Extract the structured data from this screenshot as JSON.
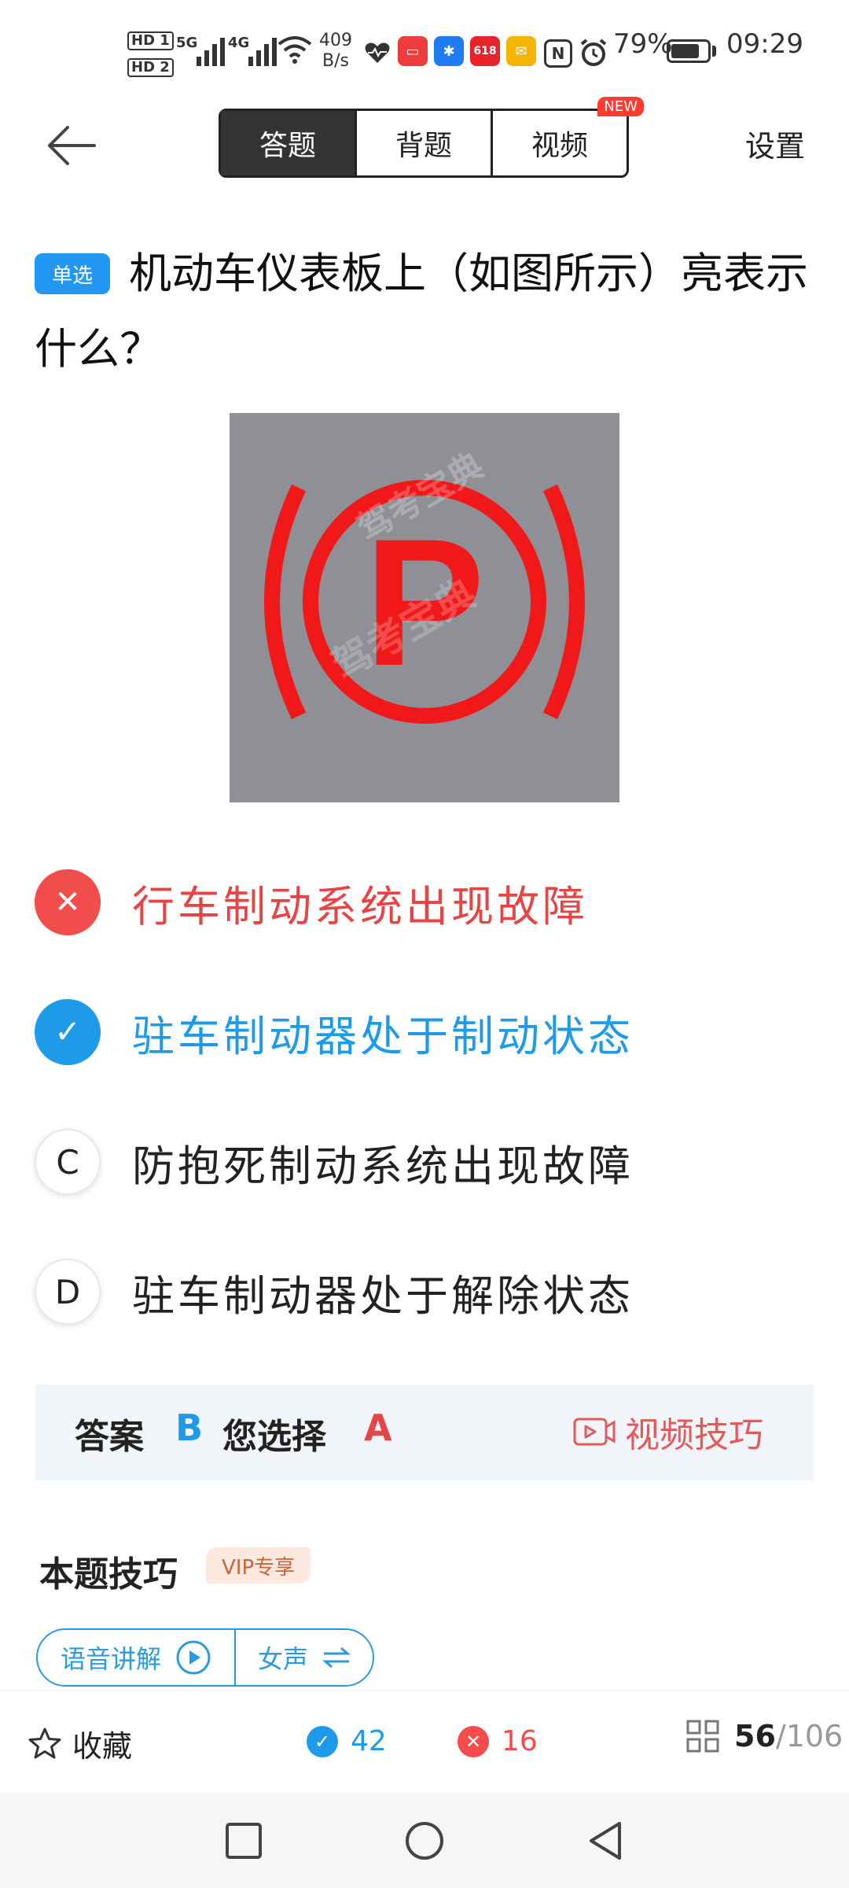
{
  "status_bar": {
    "hd1": "HD 1",
    "hd2": "HD 2",
    "net1": "5G",
    "net2": "4G",
    "speed_value": "409",
    "speed_unit": "B/s",
    "badge_618": "618",
    "battery_percent": "79%",
    "battery_level": 0.79,
    "time": "09:29"
  },
  "header": {
    "tabs": [
      {
        "label": "答题"
      },
      {
        "label": "背题"
      },
      {
        "label": "视频"
      }
    ],
    "new_badge": "NEW",
    "settings_label": "设置"
  },
  "question": {
    "type_badge": "单选",
    "text": "机动车仪表板上（如图所示）亮表示什么？",
    "image_watermark": "驾考宝典",
    "image_letter": "P"
  },
  "options": [
    {
      "marker": "✕",
      "text": "行车制动系统出现故障",
      "state": "wrong"
    },
    {
      "marker": "✓",
      "text": "驻车制动器处于制动状态",
      "state": "right"
    },
    {
      "marker": "C",
      "text": "防抱死制动系统出现故障",
      "state": "plain"
    },
    {
      "marker": "D",
      "text": "驻车制动器处于解除状态",
      "state": "plain"
    }
  ],
  "answer": {
    "answer_label": "答案",
    "answer_value": "B",
    "chosen_label": "您选择",
    "chosen_value": "A",
    "video_tip_label": "视频技巧"
  },
  "tips": {
    "title": "本题技巧",
    "vip_badge": "VIP专享",
    "voice_label": "语音讲解",
    "gender_label": "女声"
  },
  "toolbar": {
    "favorite_label": "收藏",
    "correct_count": "42",
    "wrong_count": "16",
    "current_index": "56",
    "total": "/106"
  },
  "colors": {
    "accent_blue": "#1e9be8",
    "wrong_red": "#e64545",
    "icon_red": "#f01818"
  }
}
